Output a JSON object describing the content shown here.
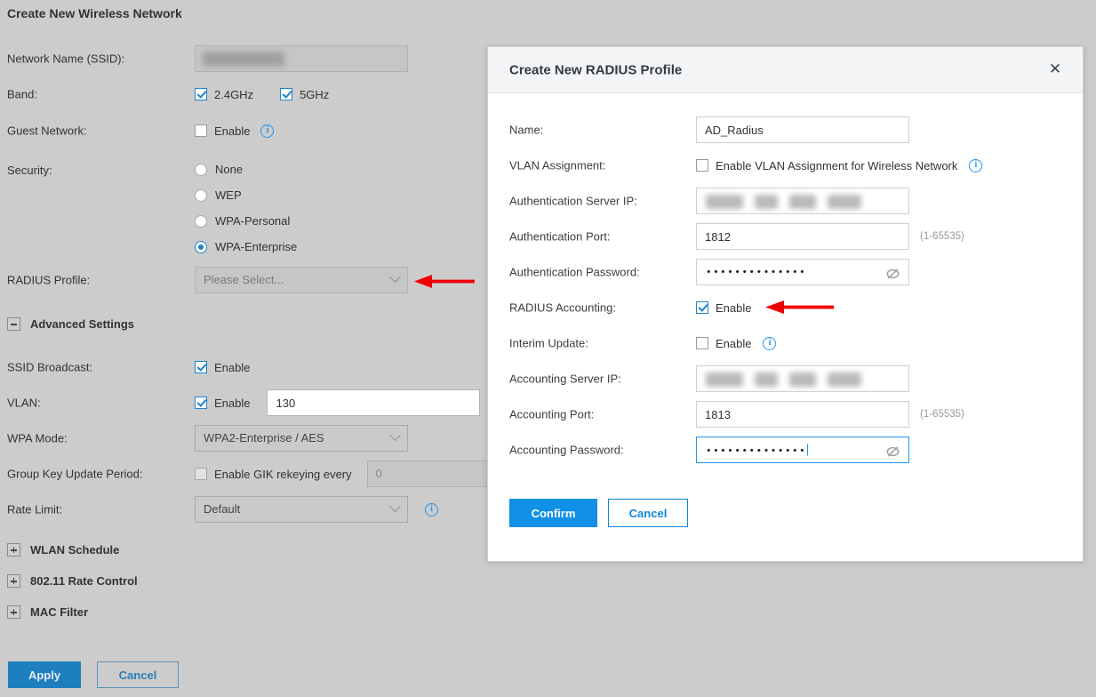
{
  "page": {
    "title": "Create New Wireless Network",
    "fields": {
      "ssid_label": "Network Name (SSID):",
      "ssid_value": "",
      "band_label": "Band:",
      "band_24_label": "2.4GHz",
      "band_5_label": "5GHz",
      "guest_label": "Guest Network:",
      "guest_enable_label": "Enable",
      "security_label": "Security:",
      "security_options": [
        "None",
        "WEP",
        "WPA-Personal",
        "WPA-Enterprise"
      ],
      "security_selected": "WPA-Enterprise",
      "radius_profile_label": "RADIUS Profile:",
      "radius_profile_placeholder": "Please Select..."
    },
    "advanced": {
      "section_label": "Advanced Settings",
      "ssid_broadcast_label": "SSID Broadcast:",
      "ssid_broadcast_enable": "Enable",
      "vlan_label": "VLAN:",
      "vlan_enable": "Enable",
      "vlan_value": "130",
      "wpa_mode_label": "WPA Mode:",
      "wpa_mode_value": "WPA2-Enterprise / AES",
      "gik_label": "Group Key Update Period:",
      "gik_enable": "Enable GIK rekeying every",
      "gik_value": "0",
      "rate_limit_label": "Rate Limit:",
      "rate_limit_value": "Default"
    },
    "collapsed_sections": [
      "WLAN Schedule",
      "802.11 Rate Control",
      "MAC Filter"
    ],
    "footer": {
      "apply_label": "Apply",
      "cancel_label": "Cancel"
    }
  },
  "modal": {
    "title": "Create New RADIUS Profile",
    "close_label": "✕",
    "fields": {
      "name_label": "Name:",
      "name_value": "AD_Radius",
      "vlan_assignment_label": "VLAN Assignment:",
      "vlan_assignment_checkbox": "Enable VLAN Assignment for Wireless Network",
      "auth_server_ip_label": "Authentication Server IP:",
      "auth_server_ip_value": "",
      "auth_port_label": "Authentication Port:",
      "auth_port_value": "1812",
      "auth_port_hint": "(1-65535)",
      "auth_password_label": "Authentication Password:",
      "auth_password_dots": "••••••••••••••",
      "radius_accounting_label": "RADIUS Accounting:",
      "radius_accounting_enable": "Enable",
      "interim_update_label": "Interim Update:",
      "interim_update_enable": "Enable",
      "acct_server_ip_label": "Accounting Server IP:",
      "acct_server_ip_value": "",
      "acct_port_label": "Accounting Port:",
      "acct_port_value": "1813",
      "acct_port_hint": "(1-65535)",
      "acct_password_label": "Accounting Password:",
      "acct_password_dots": "••••••••••••••"
    },
    "footer": {
      "confirm_label": "Confirm",
      "cancel_label": "Cancel"
    }
  },
  "annotations": {
    "arrow_color": "#ee0000",
    "arrow_1_target": "radius-profile-select",
    "arrow_2_target": "radius-accounting-checkbox"
  },
  "colors": {
    "page_background": "#cccccc",
    "accent_blue": "#1d84c8",
    "confirm_blue": "#1090e6",
    "apply_blue": "#1d7fbe",
    "info_blue": "#2196f3"
  }
}
